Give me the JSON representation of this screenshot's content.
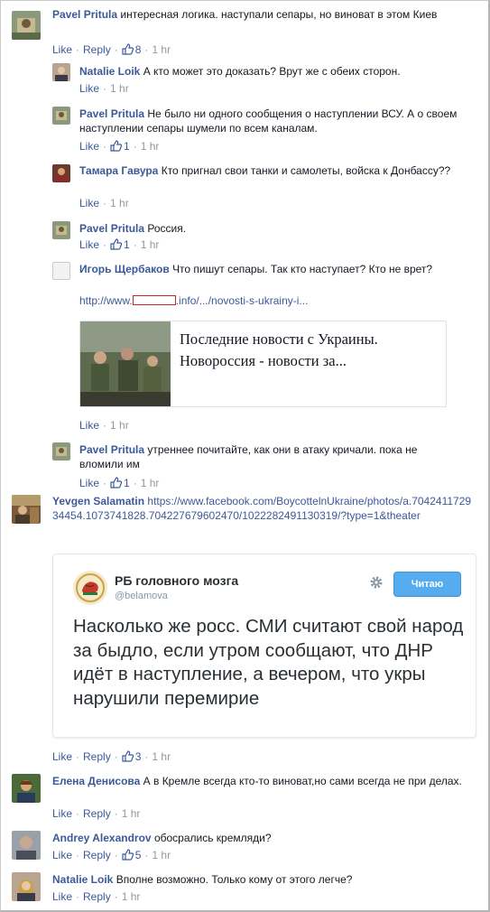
{
  "comments": [
    {
      "author": "Pavel Pritula",
      "text": "интересная логика. наступали сепары, но виноват в этом Киев",
      "like": "Like",
      "reply": "Reply",
      "likes": "8",
      "time": "1 hr"
    },
    {
      "author": "Natalie Loik",
      "text": "А кто может это доказать? Врут же с обеих сторон.",
      "like": "Like",
      "time": "1 hr"
    },
    {
      "author": "Pavel Pritula",
      "text": "Не было ни одного сообщения о наступлении ВСУ. А о своем наступлении сепары шумели по всем каналам.",
      "like": "Like",
      "likes": "1",
      "time": "1 hr"
    },
    {
      "author": "Тамара Гавура",
      "text": "Кто пригнал свои танки и самолеты, войска к Донбассу??",
      "like": "Like",
      "time": "1 hr"
    },
    {
      "author": "Pavel Pritula",
      "text": "Россия.",
      "like": "Like",
      "likes": "1",
      "time": "1 hr"
    },
    {
      "author": "Игорь Щербаков",
      "text": "Что пишут сепары. Так кто наступает? Кто не врет?",
      "link_prefix": "http://www.",
      "link_suffix": ".info/.../novosti-s-ukrainy-i...",
      "preview_title": "Последние новости с Украины. Новороссия - новости за...",
      "like": "Like",
      "time": "1 hr"
    },
    {
      "author": "Pavel Pritula",
      "text": "утреннее почитайте, как они в атаку кричали. пока не вломили им",
      "like": "Like",
      "likes": "1",
      "time": "1 hr"
    },
    {
      "author": "Yevgen Salamatin",
      "link": "https://www.facebook.com/BoycottelnUkraine/photos/a.704241172934454.1073741828.704227679602470/1022282491130319/?type=1&theater",
      "like": "Like",
      "reply": "Reply",
      "likes": "3",
      "time": "1 hr"
    },
    {
      "author": "Елена Денисова",
      "text": "А в Кремле всегда кто-то виноват,но сами всегда не при делах.",
      "like": "Like",
      "reply": "Reply",
      "time": "1 hr"
    },
    {
      "author": "Andrey Alexandrov",
      "text": "обосрались кремляди?",
      "like": "Like",
      "reply": "Reply",
      "likes": "5",
      "time": "1 hr"
    },
    {
      "author": "Natalie Loik",
      "text": "Вполне возможно. Только кому от этого легче?",
      "like": "Like",
      "reply": "Reply",
      "time": "1 hr"
    }
  ],
  "tweet": {
    "name": "РБ головного мозга",
    "handle": "@belamova",
    "follow_label": "Читаю",
    "text": "Насколько же росс. СМИ считают свой народ за быдло, если утром сообщают, что ДНР идёт в наступление, а вечером, что укры нарушили перемирие"
  },
  "colors": {
    "link": "#3b5998",
    "meta": "#9197a3",
    "follow": "#55acee"
  }
}
